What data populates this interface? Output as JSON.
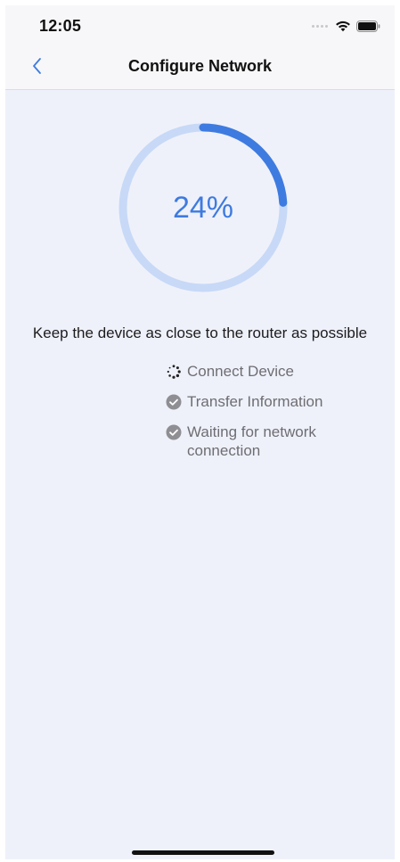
{
  "status_bar": {
    "time": "12:05"
  },
  "nav": {
    "back_icon": "chevron-left-icon",
    "title": "Configure Network"
  },
  "progress": {
    "percent": 24,
    "label": "24%",
    "colors": {
      "track": "#c7d9f7",
      "fill": "#3e7be0"
    }
  },
  "hint": "Keep the device as close to the router as possible",
  "steps": [
    {
      "label": "Connect Device",
      "state": "in-progress",
      "icon": "spinner-icon"
    },
    {
      "label": "Transfer Information",
      "state": "done",
      "icon": "check-circle-icon"
    },
    {
      "label": "Waiting for network connection",
      "state": "done",
      "icon": "check-circle-icon"
    }
  ]
}
